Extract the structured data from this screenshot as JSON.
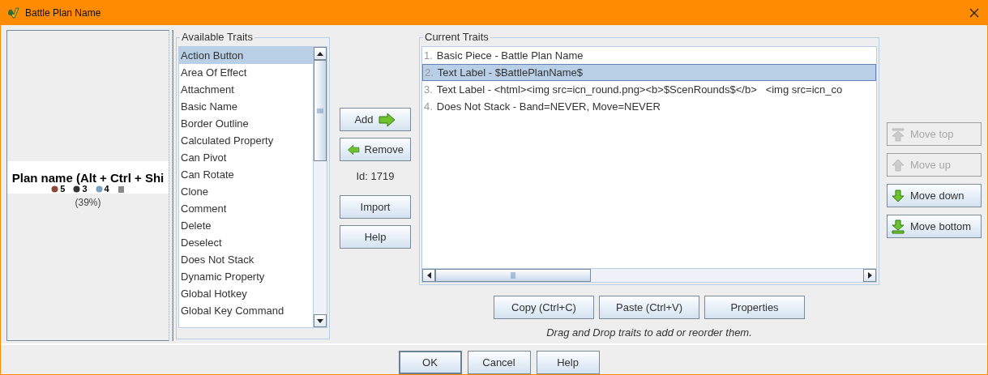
{
  "window": {
    "title": "Battle Plan Name"
  },
  "preview": {
    "name_text": "Plan name (Alt + Ctrl + Shi",
    "counts": [
      "5",
      "3",
      "4"
    ],
    "zoom": "(39%)"
  },
  "available_traits": {
    "title": "Available Traits",
    "items": [
      {
        "label": "Action Button",
        "selected": true
      },
      {
        "label": "Area Of Effect",
        "selected": false
      },
      {
        "label": "Attachment",
        "selected": false
      },
      {
        "label": "Basic Name",
        "selected": false
      },
      {
        "label": "Border Outline",
        "selected": false
      },
      {
        "label": "Calculated Property",
        "selected": false
      },
      {
        "label": "Can Pivot",
        "selected": false
      },
      {
        "label": "Can Rotate",
        "selected": false
      },
      {
        "label": "Clone",
        "selected": false
      },
      {
        "label": "Comment",
        "selected": false
      },
      {
        "label": "Delete",
        "selected": false
      },
      {
        "label": "Deselect",
        "selected": false
      },
      {
        "label": "Does Not Stack",
        "selected": false
      },
      {
        "label": "Dynamic Property",
        "selected": false
      },
      {
        "label": "Global Hotkey",
        "selected": false
      },
      {
        "label": "Global Key Command",
        "selected": false
      }
    ]
  },
  "middle": {
    "transfer_buttons": [
      {
        "label": "Add",
        "kind": "add"
      },
      {
        "label": "Remove",
        "kind": "remove"
      }
    ],
    "id_label": "Id: 1719",
    "other_buttons": [
      "Import",
      "Help"
    ]
  },
  "current_traits": {
    "title": "Current Traits",
    "items": [
      {
        "number": "1.",
        "label": "Basic Piece - Battle Plan Name",
        "selected": false
      },
      {
        "number": "2.",
        "label": "Text Label - $BattlePlanName$",
        "selected": true
      },
      {
        "number": "3.",
        "label": "Text Label - <html><img src=icn_round.png><b>$ScenRounds$</b>   <img src=icn_co",
        "selected": false
      },
      {
        "number": "4.",
        "label": "Does Not Stack - Band=NEVER, Move=NEVER",
        "selected": false
      }
    ]
  },
  "move_buttons": [
    {
      "label": "Move top",
      "kind": "top",
      "disabled": true
    },
    {
      "label": "Move up",
      "kind": "up",
      "disabled": true
    },
    {
      "label": "Move down",
      "kind": "down",
      "disabled": false
    },
    {
      "label": "Move bottom",
      "kind": "bottom",
      "disabled": false
    }
  ],
  "edit_buttons": [
    "Copy (Ctrl+C)",
    "Paste (Ctrl+V)",
    "Properties"
  ],
  "hint": "Drag and Drop traits to add or reorder them.",
  "footer_buttons": [
    "OK",
    "Cancel",
    "Help"
  ]
}
